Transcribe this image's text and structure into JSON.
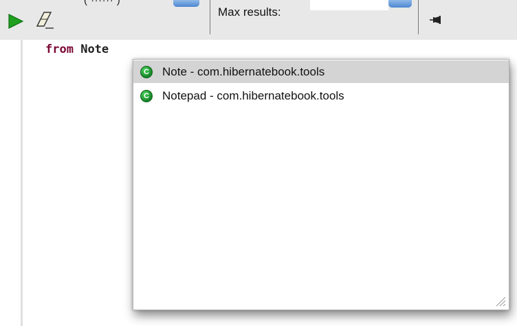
{
  "toolbar": {
    "run_icon": "run-triangle-icon",
    "clear_icon": "eraser-icon",
    "max_results_label": "Max results:",
    "max_results_value": "",
    "pin_icon": "pin-icon",
    "accent_color": "#4c87d1",
    "run_color": "#1fa01f"
  },
  "editor": {
    "keyword": "from",
    "entity": "Note",
    "keyword_color": "#7a0a35"
  },
  "autocomplete": {
    "items": [
      {
        "icon": "class-icon",
        "badge": "C",
        "label": "Note - com.hibernatebook.tools",
        "selected": true
      },
      {
        "icon": "class-icon",
        "badge": "C",
        "label": "Notepad - com.hibernatebook.tools",
        "selected": false
      }
    ],
    "resize_icon": "resize-grip-icon"
  }
}
